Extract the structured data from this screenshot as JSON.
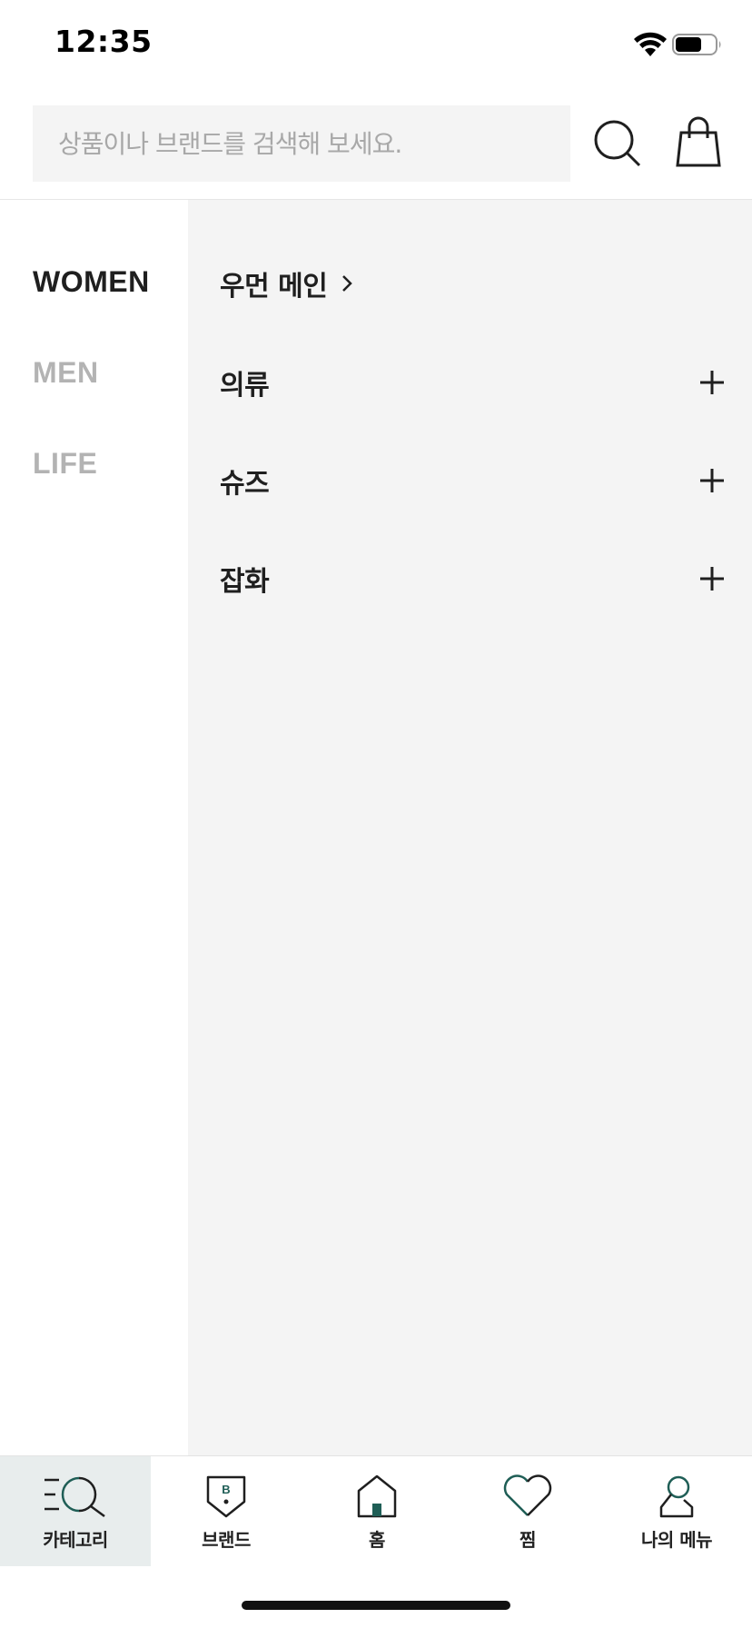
{
  "status_bar": {
    "time": "12:35"
  },
  "header": {
    "search_placeholder": "상품이나 브랜드를 검색해 보세요.",
    "search_icon": "search-icon",
    "bag_icon": "shopping-bag-icon"
  },
  "gender_tabs": [
    {
      "label": "WOMEN",
      "active": true
    },
    {
      "label": "MEN",
      "active": false
    },
    {
      "label": "LIFE",
      "active": false
    }
  ],
  "categories": {
    "main_link": {
      "label": "우먼 메인",
      "icon": "chevron-right-icon"
    },
    "items": [
      {
        "label": "의류",
        "icon": "plus-icon"
      },
      {
        "label": "슈즈",
        "icon": "plus-icon"
      },
      {
        "label": "잡화",
        "icon": "plus-icon"
      }
    ]
  },
  "tab_bar": {
    "items": [
      {
        "label": "카테고리",
        "icon": "category-search-icon",
        "active": true
      },
      {
        "label": "브랜드",
        "icon": "brand-shield-icon",
        "active": false
      },
      {
        "label": "홈",
        "icon": "home-icon",
        "active": false
      },
      {
        "label": "찜",
        "icon": "heart-icon",
        "active": false
      },
      {
        "label": "나의 메뉴",
        "icon": "user-icon",
        "active": false
      }
    ],
    "active_background": "#e8eded",
    "accent_color": "#1f5e56"
  },
  "colors": {
    "text_primary": "#1f1f1f",
    "text_inactive": "#b3b3b3",
    "panel_background": "#f4f4f4"
  }
}
